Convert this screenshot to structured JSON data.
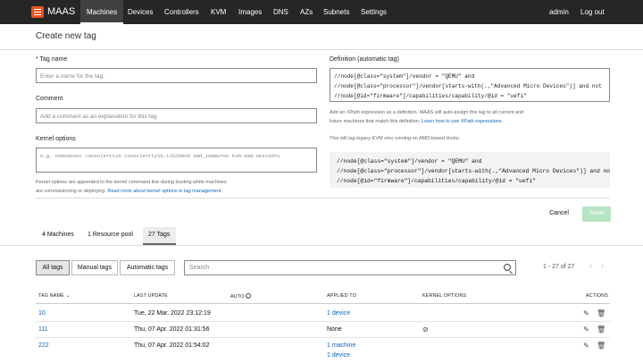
{
  "nav": {
    "brand": "MAAS",
    "links": [
      "Machines",
      "Devices",
      "Controllers",
      "KVM",
      "Images",
      "DNS",
      "AZs",
      "Subnets",
      "Settings"
    ],
    "user": "admin",
    "logout": "Log out"
  },
  "form": {
    "title": "Create new tag",
    "tag_name_label": "* Tag name",
    "tag_name_placeholder": "Enter a name for the tag.",
    "comment_label": "Comment",
    "comment_placeholder": "Add a comment as an explanation for this tag.",
    "kernel_label": "Kernel options",
    "kernel_placeholder": "e.g. nomodeset console=tty0 console=ttyS0,115200n8 amd_iommu=on kvm-amd.nested=1",
    "kernel_help_1": "Kernel options are appended to the kernel command line during booting while machines",
    "kernel_help_2": "are commissioning or deploying.",
    "kernel_help_link": "Read more about kernel options in tag management.",
    "definition_label": "Definition (automatic tag)",
    "definition_line1": "//node[@class=\"system\"]/vendor = \"QEMU\" and",
    "definition_line2": "//node[@class=\"processor\"]/vendor[starts-with(.,\"Advanced Micro Devices\")] and not",
    "definition_line3": "//node[@id=\"firmware\"]/capabilities/capability/@id = \"uefi\"",
    "definition_help_1": "Add an XPath expression as a definition. MAAS will auto-assign this tag to all current and",
    "definition_help_2": "future machines that match this definition.",
    "definition_help_link": "Learn how to use XPath expressions.",
    "kvm_note": "This will tag legacy KVM vms running on AMD-based Hosts:",
    "code_line1": "//node[@class=\"system\"]/vendor = \"QEMU\" and",
    "code_line2": "//node[@class=\"processor\"]/vendor[starts-with(.,\"Advanced Micro Devices\")] and not",
    "code_line3": "//node[@id=\"firmware\"]/capabilities/capability/@id = \"uefi\"",
    "cancel": "Cancel",
    "save": "Save"
  },
  "tabs": [
    "4 Machines",
    "1 Resource pool",
    "27 Tags"
  ],
  "filters": [
    "All tags",
    "Manual tags",
    "Automatic tags"
  ],
  "search_placeholder": "Search",
  "pagination": "1 - 27 of 27",
  "table": {
    "headers": [
      "TAG NAME",
      "LAST UPDATE",
      "AUTO",
      "APPLIED TO",
      "KERNEL OPTIONS",
      "ACTIONS"
    ],
    "rows": [
      {
        "name": "10",
        "updated": "Tue, 22 Mar. 2022 23:12:19",
        "applied": [
          "1 device"
        ],
        "kernel": false
      },
      {
        "name": "111",
        "updated": "Thu, 07 Apr. 2022 01:31:56",
        "applied_text": "None",
        "kernel": true
      },
      {
        "name": "222",
        "updated": "Thu, 07 Apr. 2022 01:54:02",
        "applied": [
          "1 machine",
          "1 device"
        ],
        "kernel": false
      }
    ]
  },
  "colors": {
    "accent": "#e95420",
    "link": "#0e67b8",
    "save": "#b7e4c3"
  }
}
